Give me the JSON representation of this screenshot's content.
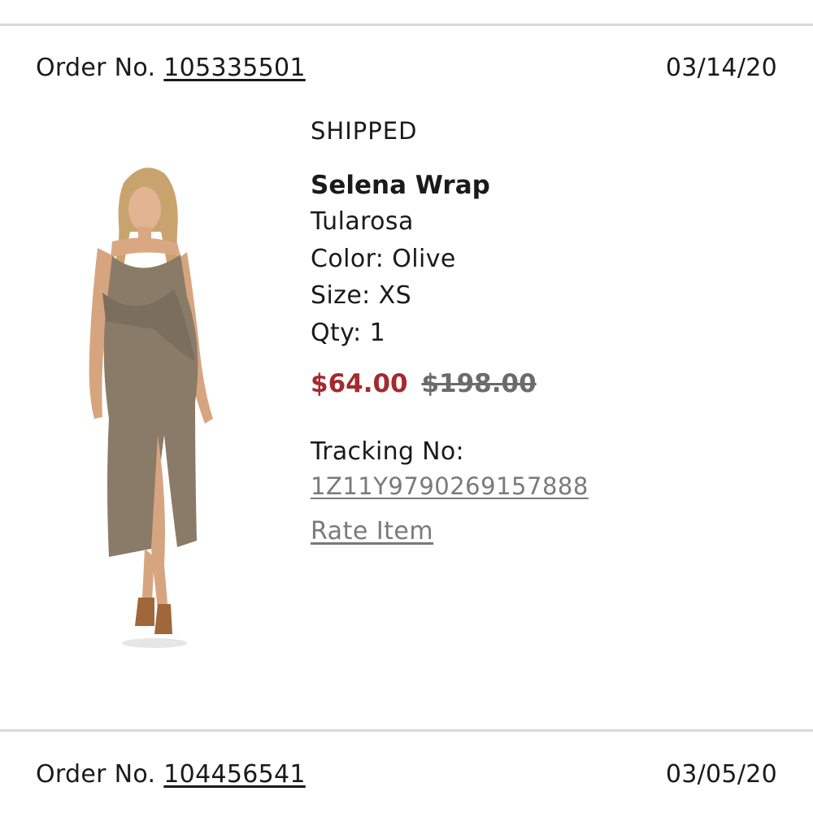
{
  "orders": [
    {
      "label": "Order No.",
      "number": "105335501",
      "date": "03/14/20",
      "status": "SHIPPED",
      "item": {
        "name": "Selena Wrap",
        "brand": "Tularosa",
        "color": "Color: Olive",
        "size": "Size: XS",
        "qty": "Qty: 1",
        "sale_price": "$64.00",
        "original_price": "$198.00",
        "tracking_label": "Tracking No:",
        "tracking_number": "1Z11Y9790269157888",
        "rate_label": "Rate Item",
        "dress_color": "#8a7b68"
      }
    },
    {
      "label": "Order No.",
      "number": "104456541",
      "date": "03/05/20"
    }
  ]
}
